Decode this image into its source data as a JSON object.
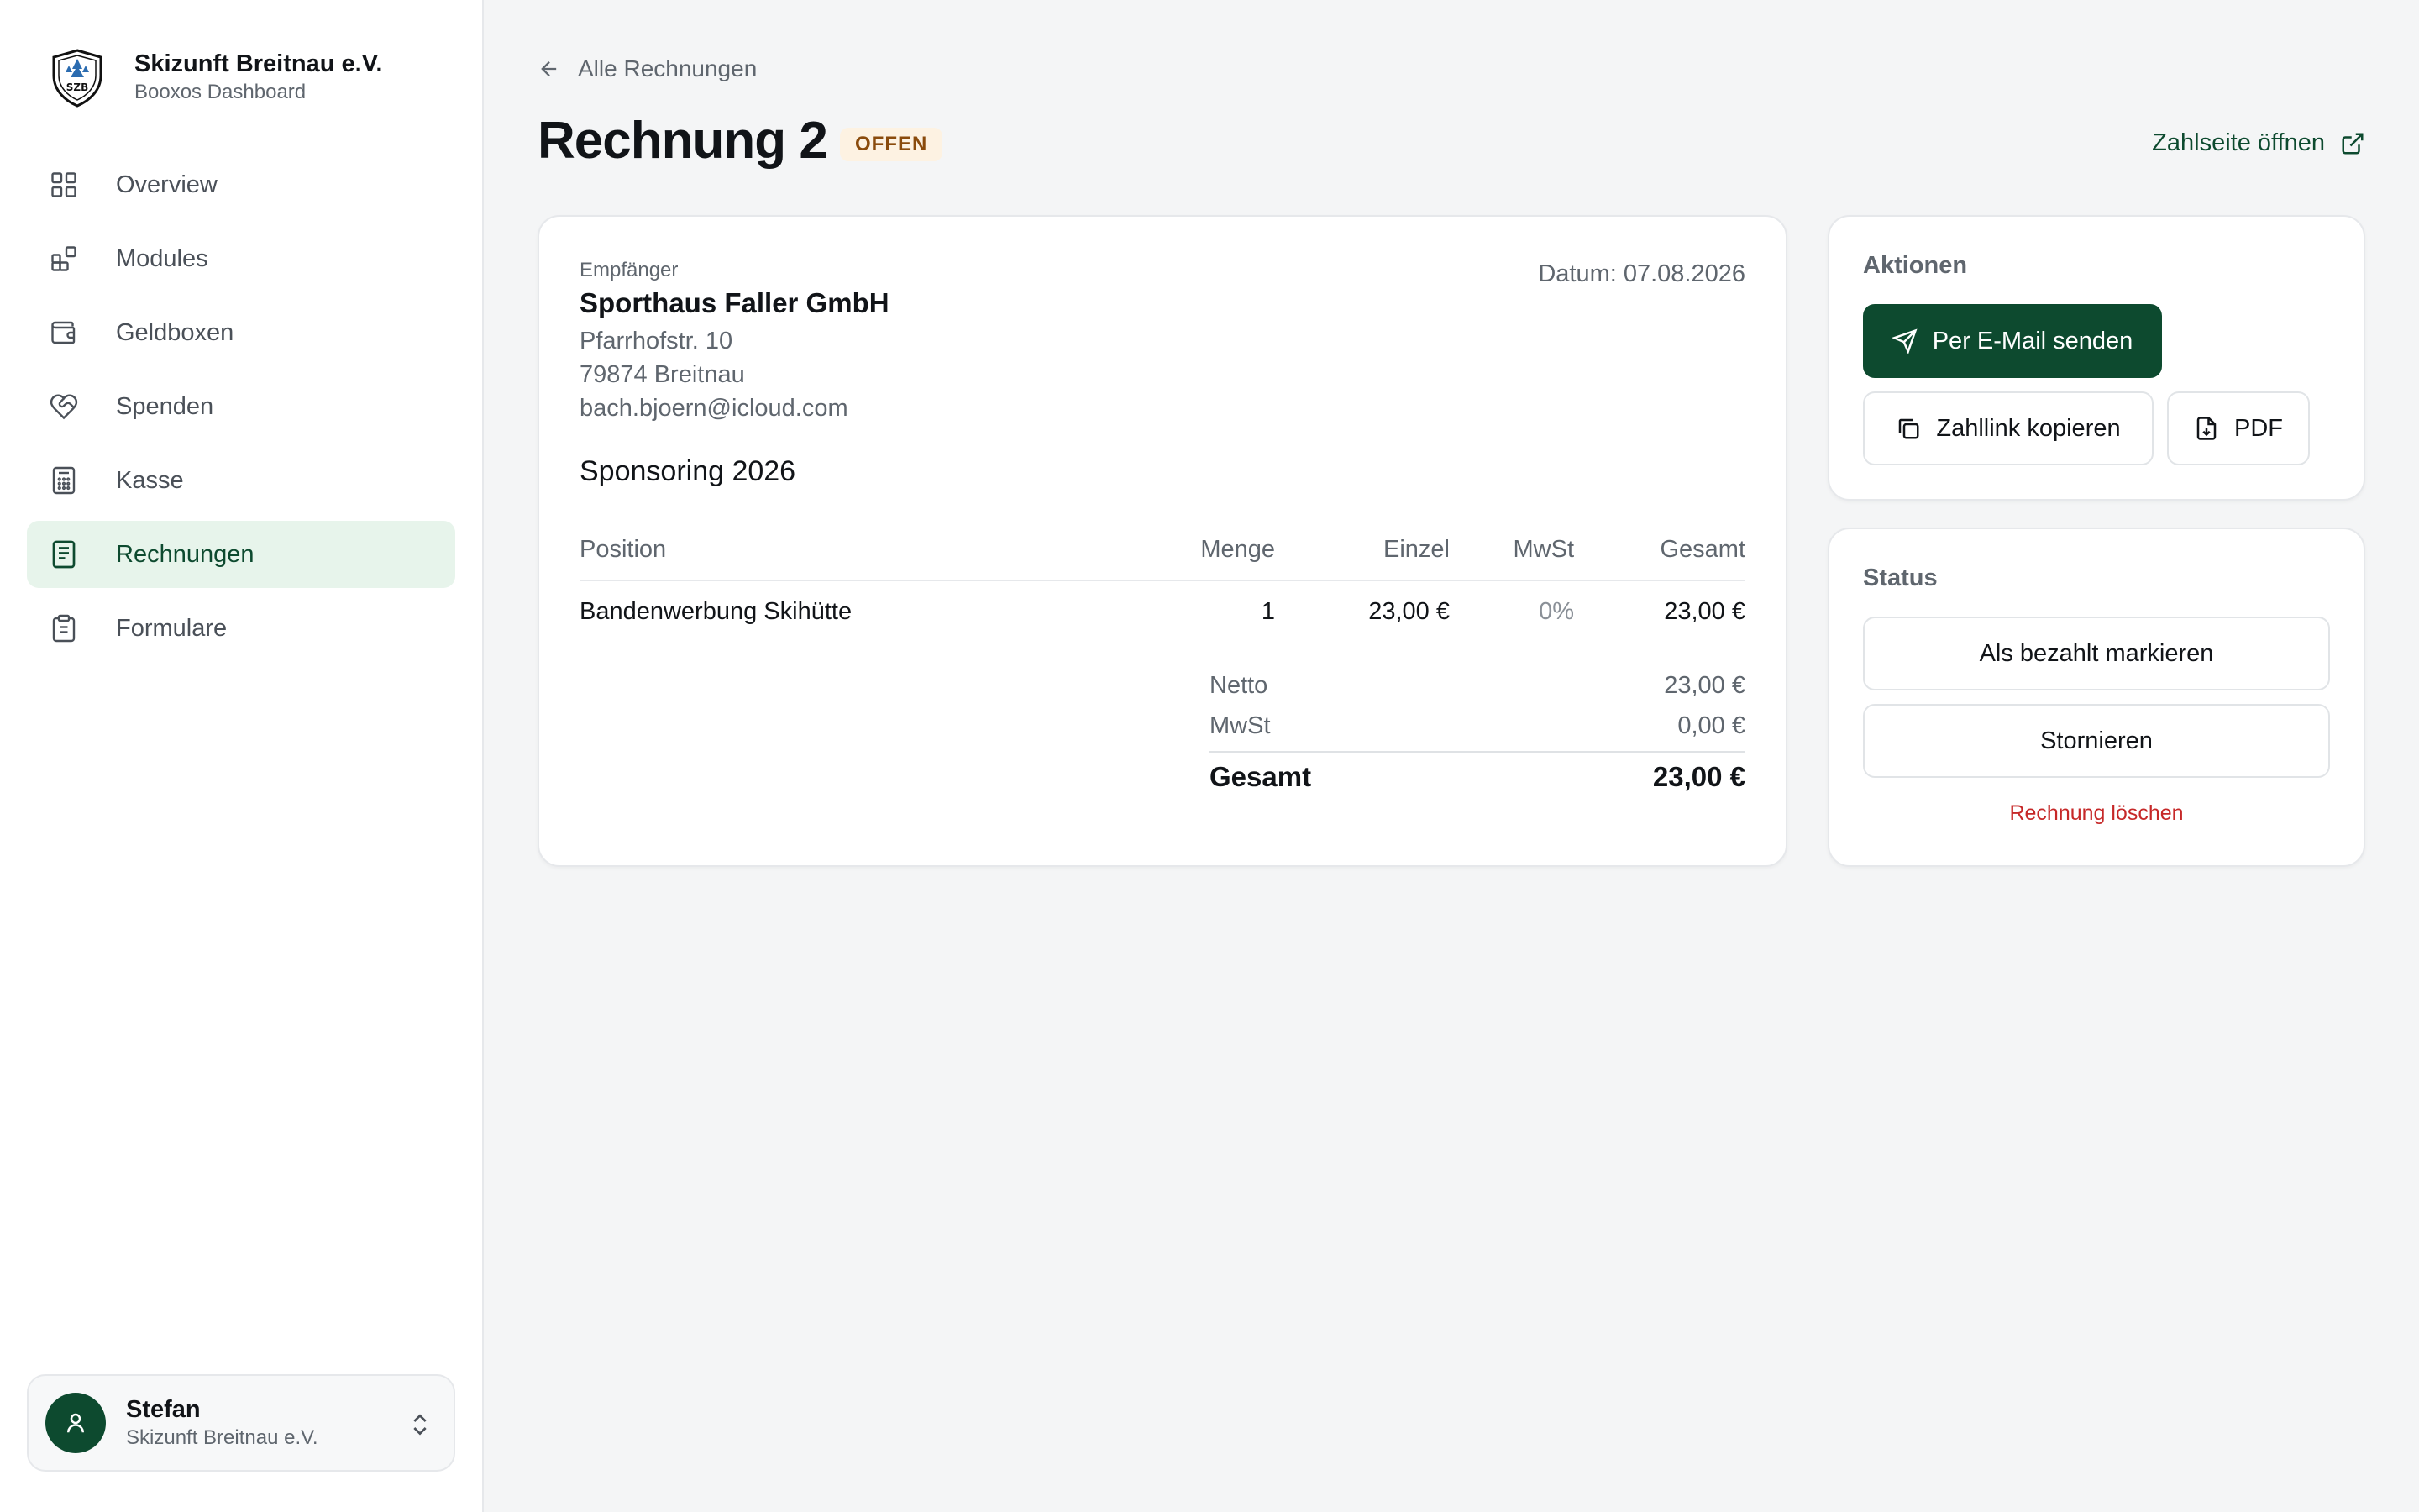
{
  "sidebar": {
    "org_name": "Skizunft Breitnau e.V.",
    "org_sub": "Booxos Dashboard",
    "logo_text": "SZB",
    "items": [
      {
        "label": "Overview",
        "icon": "grid-icon"
      },
      {
        "label": "Modules",
        "icon": "modules-icon"
      },
      {
        "label": "Geldboxen",
        "icon": "wallet-icon"
      },
      {
        "label": "Spenden",
        "icon": "heart-handshake-icon"
      },
      {
        "label": "Kasse",
        "icon": "calculator-icon"
      },
      {
        "label": "Rechnungen",
        "icon": "receipt-icon",
        "active": true
      },
      {
        "label": "Formulare",
        "icon": "clipboard-icon"
      }
    ],
    "user": {
      "name": "Stefan",
      "org": "Skizunft Breitnau e.V."
    }
  },
  "header": {
    "back_label": "Alle Rechnungen",
    "title": "Rechnung 2",
    "status_badge": "OFFEN",
    "pay_link_label": "Zahlseite öffnen"
  },
  "invoice": {
    "recipient_label": "Empfänger",
    "recipient_name": "Sporthaus Faller GmbH",
    "street": "Pfarrhofstr. 10",
    "city": "79874 Breitnau",
    "email": "bach.bjoern@icloud.com",
    "date": "Datum: 07.08.2026",
    "subject": "Sponsoring 2026",
    "columns": {
      "position": "Position",
      "qty": "Menge",
      "unit": "Einzel",
      "vat": "MwSt",
      "total": "Gesamt"
    },
    "rows": [
      {
        "position": "Bandenwerbung Skihütte",
        "qty": "1",
        "unit": "23,00 €",
        "vat": "0%",
        "total": "23,00 €"
      }
    ],
    "totals": {
      "net_label": "Netto",
      "net": "23,00 €",
      "vat_label": "MwSt",
      "vat": "0,00 €",
      "gross_label": "Gesamt",
      "gross": "23,00 €"
    }
  },
  "actions": {
    "title": "Aktionen",
    "send_email": "Per E-Mail senden",
    "copy_link": "Zahllink kopieren",
    "pdf": "PDF"
  },
  "status": {
    "title": "Status",
    "mark_paid": "Als bezahlt markieren",
    "cancel": "Stornieren",
    "delete": "Rechnung löschen"
  },
  "colors": {
    "brand": "#0d4a2f",
    "active_bg": "#e7f4eb",
    "badge_bg": "#fdf2e2",
    "danger": "#c62828"
  }
}
